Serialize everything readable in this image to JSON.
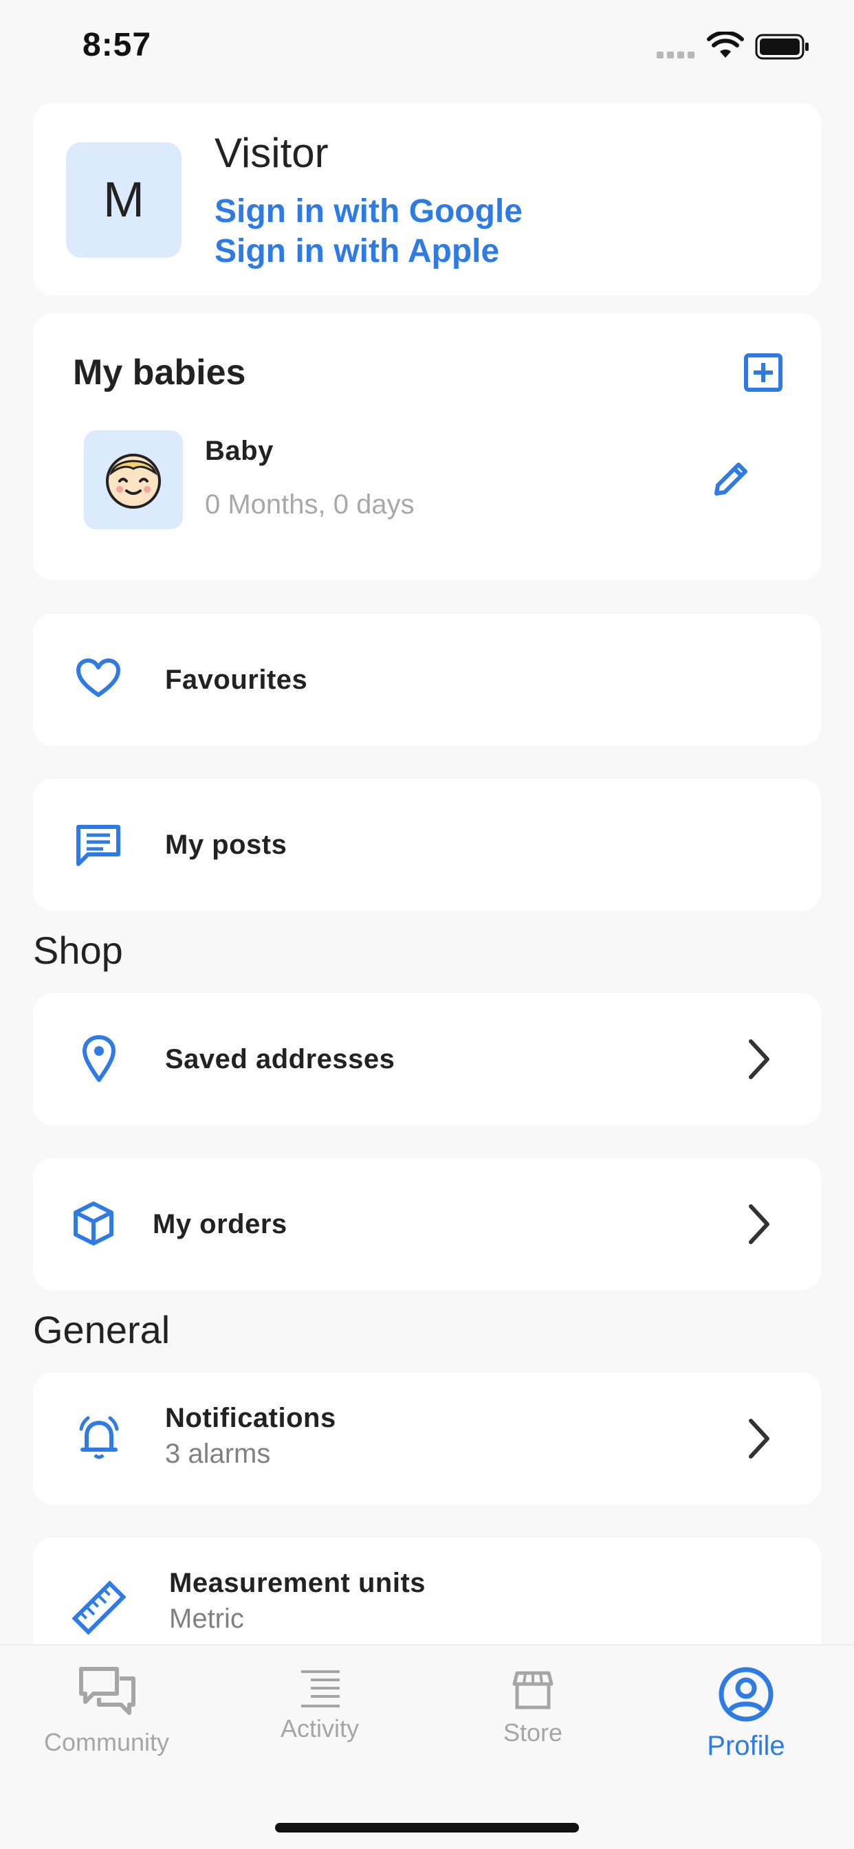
{
  "status_bar": {
    "time": "8:57"
  },
  "account": {
    "avatar_letter": "M",
    "name": "Visitor",
    "google_label": "Sign in with Google",
    "apple_label": "Sign in with Apple"
  },
  "babies": {
    "title": "My babies",
    "items": [
      {
        "name": "Baby",
        "age": "0 Months, 0 days"
      }
    ]
  },
  "menu": {
    "favourites": "Favourites",
    "my_posts": "My posts"
  },
  "shop": {
    "title": "Shop",
    "saved_addresses": "Saved addresses",
    "my_orders": "My orders"
  },
  "general": {
    "title": "General",
    "notifications": {
      "label": "Notifications",
      "value": "3 alarms"
    },
    "units": {
      "label": "Measurement units",
      "value": "Metric"
    }
  },
  "tabs": [
    {
      "label": "Community",
      "icon": "chat-bubbles-icon"
    },
    {
      "label": "Activity",
      "icon": "list-icon"
    },
    {
      "label": "Store",
      "icon": "store-icon"
    },
    {
      "label": "Profile",
      "icon": "profile-icon"
    }
  ],
  "colors": {
    "accent": "#2f7be6",
    "background": "#f8f8f8",
    "inactive": "#a6a6a6"
  }
}
